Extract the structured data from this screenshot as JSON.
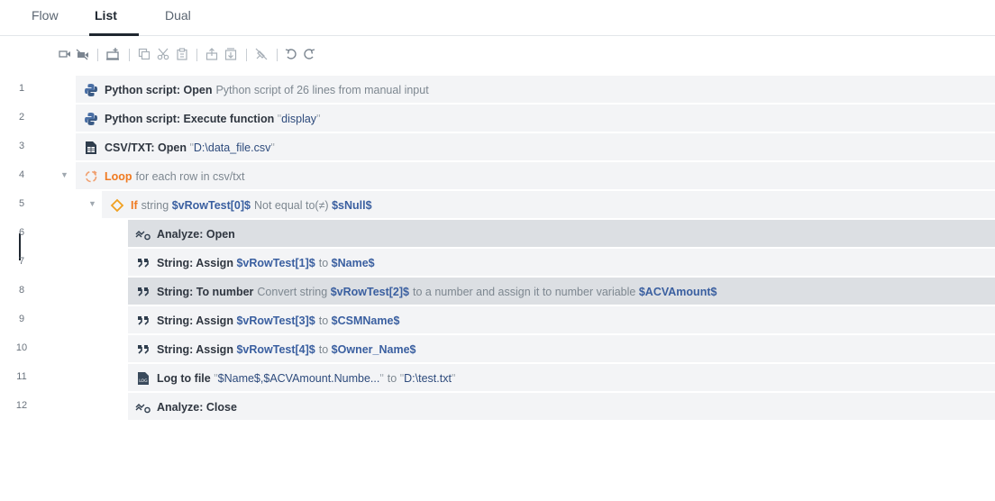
{
  "tabs": [
    {
      "label": "Flow"
    },
    {
      "label": "List"
    },
    {
      "label": "Dual"
    }
  ],
  "toolbar": {
    "icons": [
      "record-icon",
      "no-record-icon",
      "insert-action-icon",
      "copy-icon",
      "cut-icon",
      "paste-icon",
      "move-up-icon",
      "move-down-icon",
      "disable-icon",
      "undo-icon",
      "redo-icon"
    ]
  },
  "rows": [
    {
      "num": "1",
      "kw": "Python script: Open",
      "desc": "Python script of 26 lines from manual input"
    },
    {
      "num": "2",
      "kw": "Python script: Execute function",
      "str": "display"
    },
    {
      "num": "3",
      "kw": "CSV/TXT: Open",
      "str": "D:\\data_file.csv"
    },
    {
      "num": "4",
      "kw": "Loop",
      "desc": "for each row in csv/txt"
    },
    {
      "num": "5",
      "kw": "If",
      "pre": "string",
      "var1": "$vRowTest[0]$",
      "mid": "Not equal to(≠)",
      "var2": "$sNull$"
    },
    {
      "num": "6",
      "kw": "Analyze: Open"
    },
    {
      "num": "7",
      "kw": "String: Assign",
      "var1": "$vRowTest[1]$",
      "mid": "to",
      "var2": "$Name$"
    },
    {
      "num": "8",
      "kw": "String: To number",
      "pre": "Convert string",
      "var1": "$vRowTest[2]$",
      "mid": "to a number and assign it to number variable",
      "var2": "$ACVAmount$"
    },
    {
      "num": "9",
      "kw": "String: Assign",
      "var1": "$vRowTest[3]$",
      "mid": "to",
      "var2": "$CSMName$"
    },
    {
      "num": "10",
      "kw": "String: Assign",
      "var1": "$vRowTest[4]$",
      "mid": "to",
      "var2": "$Owner_Name$"
    },
    {
      "num": "11",
      "kw": "Log to file",
      "str1": "$Name$,$ACVAmount.Numbe...",
      "mid": "to",
      "str2": "D:\\test.txt"
    },
    {
      "num": "12",
      "kw": "Analyze: Close"
    }
  ]
}
